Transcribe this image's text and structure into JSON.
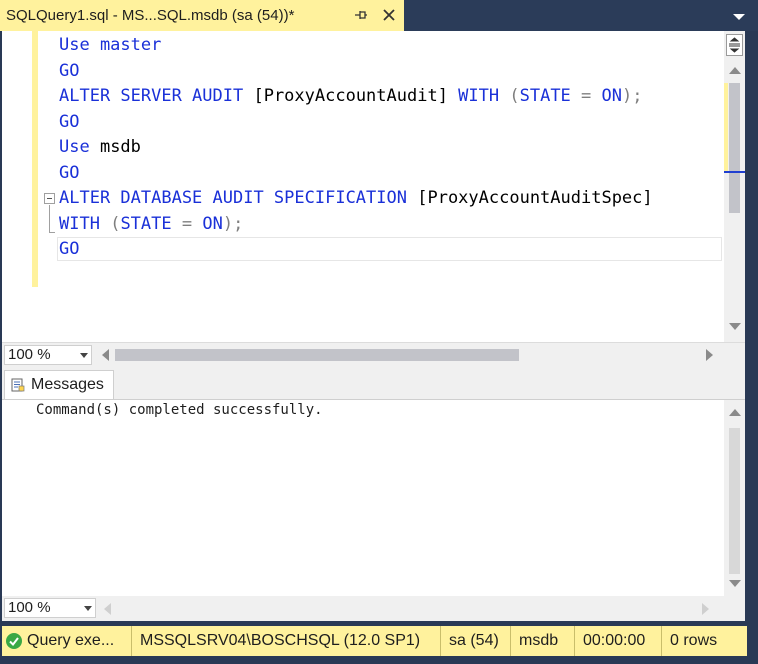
{
  "tab": {
    "title": "SQLQuery1.sql - MS...SQL.msdb (sa (54))*",
    "pin_icon": "pin-icon",
    "close_icon": "close-icon"
  },
  "editor": {
    "lines": [
      [
        {
          "t": "Use master",
          "c": "kw"
        }
      ],
      [
        {
          "t": "GO",
          "c": "kw"
        }
      ],
      [
        {
          "t": "ALTER SERVER AUDIT",
          "c": "kw"
        },
        {
          "t": " [ProxyAccountAudit] ",
          "c": ""
        },
        {
          "t": "WITH",
          "c": "kw"
        },
        {
          "t": " (",
          "c": "op"
        },
        {
          "t": "STATE",
          "c": "kw"
        },
        {
          "t": " = ",
          "c": "op"
        },
        {
          "t": "ON",
          "c": "kw"
        },
        {
          "t": ");",
          "c": "op"
        }
      ],
      [
        {
          "t": "GO",
          "c": "kw"
        }
      ],
      [
        {
          "t": "Use",
          "c": "kw"
        },
        {
          "t": " msdb",
          "c": ""
        }
      ],
      [
        {
          "t": "GO",
          "c": "kw"
        }
      ],
      [
        {
          "t": "ALTER DATABASE AUDIT SPECIFICATION",
          "c": "kw"
        },
        {
          "t": " [ProxyAccountAuditSpec]",
          "c": ""
        }
      ],
      [
        {
          "t": "WITH",
          "c": "kw"
        },
        {
          "t": " (",
          "c": "op"
        },
        {
          "t": "STATE",
          "c": "kw"
        },
        {
          "t": " = ",
          "c": "op"
        },
        {
          "t": "ON",
          "c": "kw"
        },
        {
          "t": ");",
          "c": "op"
        }
      ],
      [
        {
          "t": "GO",
          "c": "kw"
        }
      ]
    ],
    "zoom": "100 %"
  },
  "results": {
    "tab_label": "Messages",
    "message": "Command(s) completed successfully.",
    "zoom": "100 %"
  },
  "status": {
    "query": "Query  exe...",
    "server": "MSSQLSRV04\\BOSCHSQL (12.0 SP1)",
    "user": "sa (54)",
    "database": "msdb",
    "elapsed": "00:00:00",
    "rows": "0 rows"
  },
  "colors": {
    "accent_yellow": "#fff29d",
    "keyword_blue": "#1a30d8",
    "frame_navy": "#293955"
  }
}
